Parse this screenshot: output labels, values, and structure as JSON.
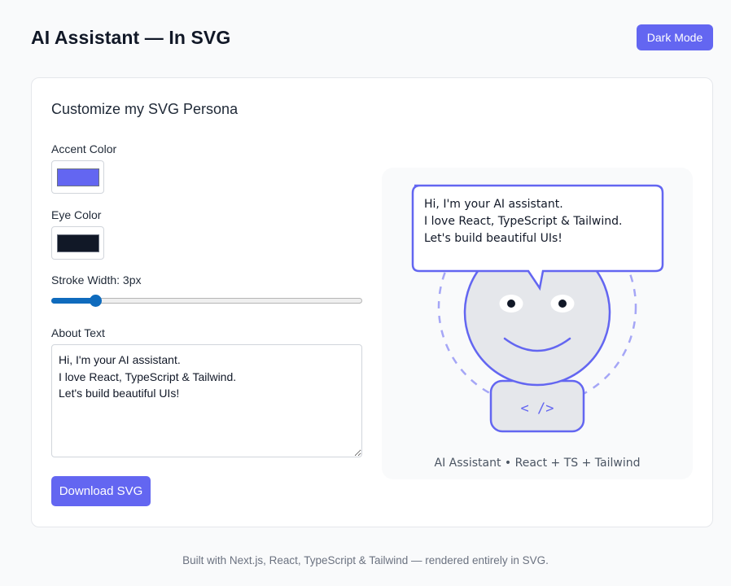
{
  "header": {
    "title": "AI Assistant — In SVG",
    "dark_mode_label": "Dark Mode"
  },
  "card": {
    "title": "Customize my SVG Persona",
    "accent": {
      "label": "Accent Color",
      "value": "#6366f1"
    },
    "eye": {
      "label": "Eye Color",
      "value": "#111827"
    },
    "stroke": {
      "label": "Stroke Width: 3px",
      "value": 3,
      "min": 1,
      "max": 20
    },
    "about": {
      "label": "About Text",
      "value": "Hi, I'm your AI assistant.\nI love React, TypeScript & Tailwind.\nLet's build beautiful UIs!"
    },
    "download_label": "Download SVG"
  },
  "preview": {
    "bubble_lines": [
      "Hi, I'm your AI assistant.",
      "I love React, TypeScript & Tailwind.",
      "Let's build beautiful UIs!"
    ],
    "code_glyph": "< />",
    "caption": "AI Assistant • React + TS + Tailwind"
  },
  "footer": {
    "text": "Built with Next.js, React, TypeScript & Tailwind — rendered entirely in SVG."
  },
  "colors": {
    "accent": "#6366f1",
    "face_fill": "#e5e7eb",
    "eye": "#111827"
  }
}
